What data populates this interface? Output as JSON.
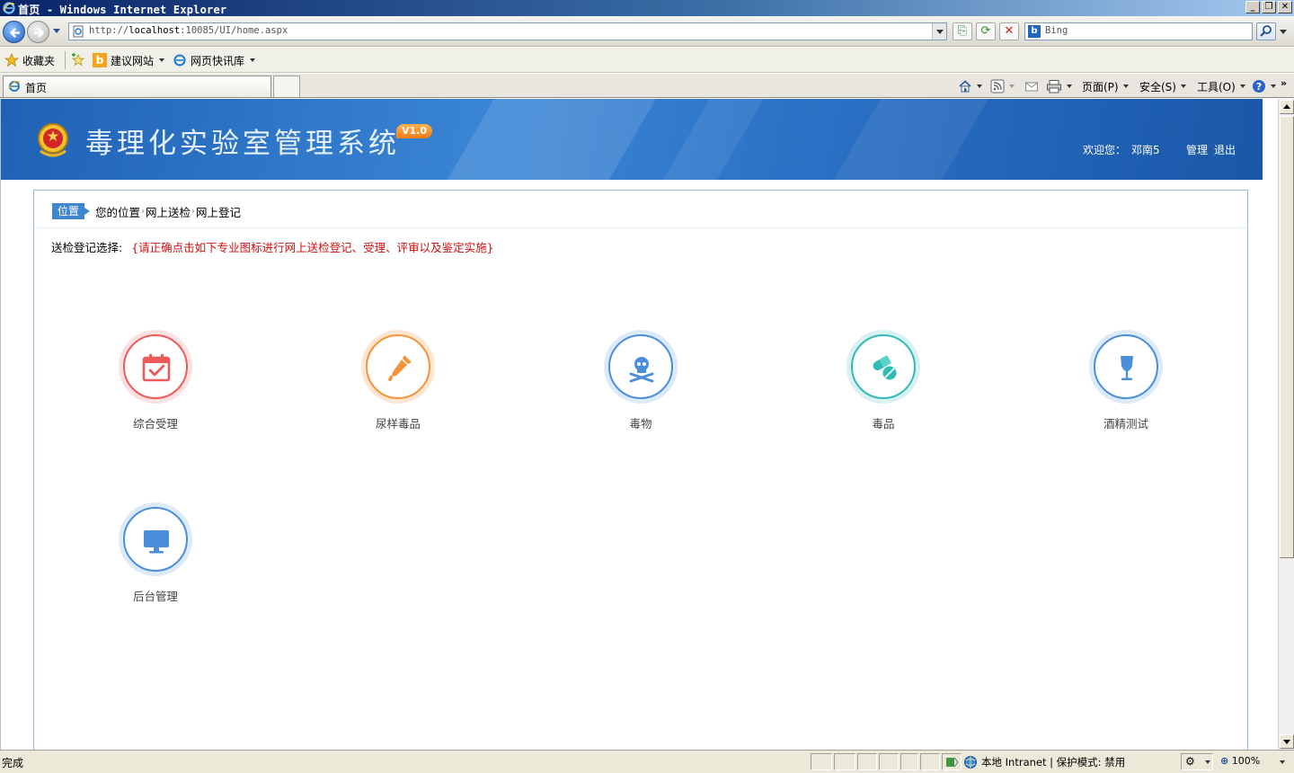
{
  "browser": {
    "title": "首页 - Windows Internet Explorer",
    "url_prefix": "http://",
    "url_host": "localhost",
    "url_rest": ":10085/UI/home.aspx",
    "search_placeholder": "Bing",
    "favorites_label": "收藏夹",
    "fav_items": [
      "建议网站",
      "网页快讯库"
    ],
    "tab_label": "首页",
    "commands": [
      "页面(P)",
      "安全(S)",
      "工具(O)"
    ],
    "status_text": "完成",
    "zone_text": "本地 Intranet | 保护模式: 禁用",
    "zoom_text": "100%"
  },
  "app": {
    "title": "毒理化实验室管理系统",
    "version": "V1.0",
    "welcome_label": "欢迎您：",
    "user_name": "邓南5",
    "manage_link": "管理",
    "logout_link": "退出",
    "location_tag": "位置",
    "breadcrumb": [
      "您的位置",
      "网上送检",
      "网上登记"
    ],
    "instruction_label": "送检登记选择:",
    "instruction_hint": "{请正确点击如下专业图标进行网上送检登记、受理、评审以及鉴定实施}",
    "tiles": [
      {
        "label": "综合受理",
        "icon": "calendar-check-icon",
        "color": "#ee5a5a"
      },
      {
        "label": "尿样毒品",
        "icon": "dropper-icon",
        "color": "#f5933a"
      },
      {
        "label": "毒物",
        "icon": "skull-crossbones-icon",
        "color": "#4b8fdc"
      },
      {
        "label": "毒品",
        "icon": "pills-icon",
        "color": "#2fbcb4"
      },
      {
        "label": "酒精测试",
        "icon": "wine-glass-icon",
        "color": "#4b8fdc"
      },
      {
        "label": "后台管理",
        "icon": "monitor-icon",
        "color": "#4b8fdc"
      }
    ]
  }
}
